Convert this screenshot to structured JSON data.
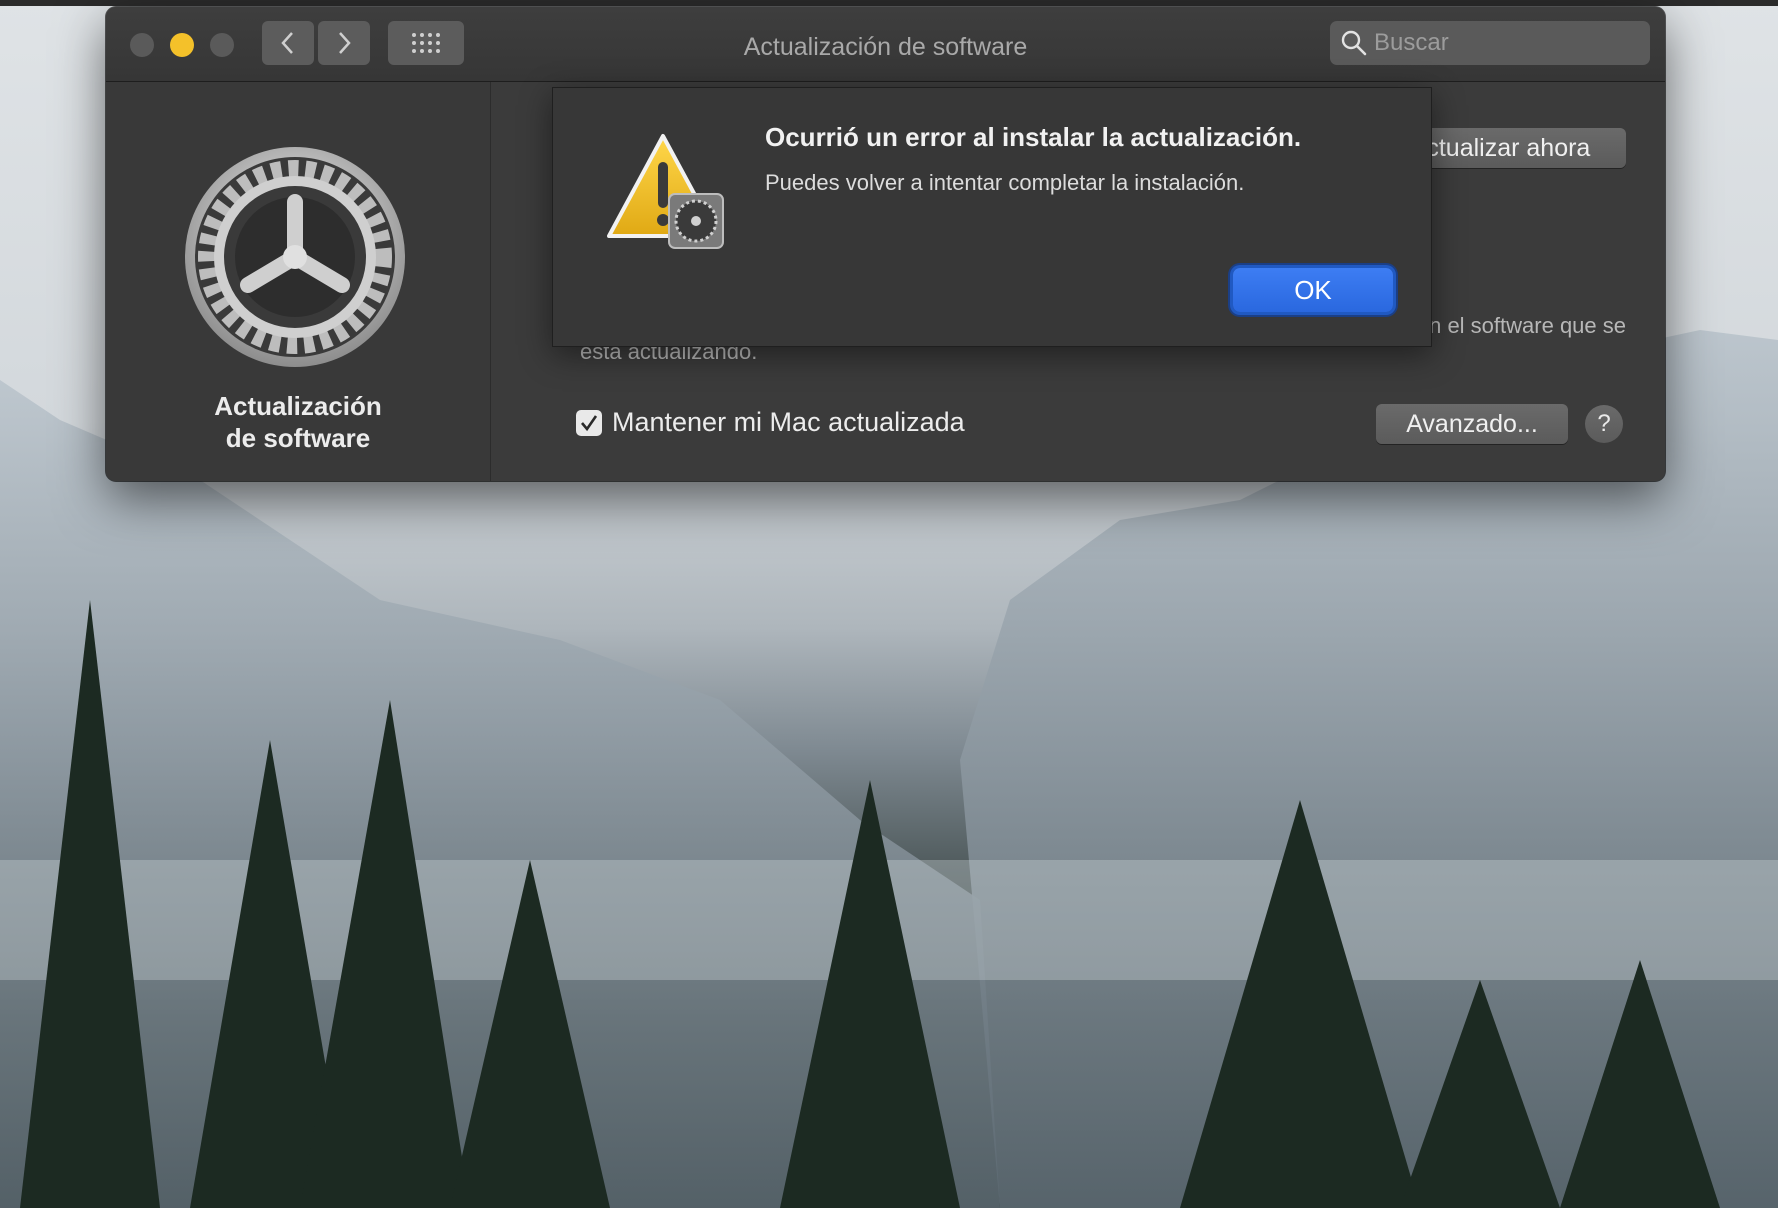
{
  "window": {
    "title": "Actualización de software",
    "search_placeholder": "Buscar",
    "traffic_lights": [
      "close",
      "minimize",
      "zoom"
    ]
  },
  "icons": {
    "nav_back": "chevron-left-icon",
    "nav_forward": "chevron-right-icon",
    "show_all": "grid-icon",
    "search": "search-icon",
    "preference_pane": "gear-icon",
    "alert": "warning-icon"
  },
  "sidebar": {
    "title": "Actualización de software"
  },
  "main": {
    "update_button": "Actualizar ahora",
    "description_line1_visible": "venía con el software que se",
    "description_line2": "está actualizando.",
    "keep_updated_label": "Mantener mi Mac actualizada",
    "keep_updated_checked": true,
    "advanced_button": "Avanzado...",
    "help_button": "?"
  },
  "alert": {
    "title": "Ocurrió un error al instalar la actualización.",
    "message": "Puedes volver a intentar completar la instalación.",
    "ok_button": "OK"
  },
  "colors": {
    "window_bg": "#3b3b3b",
    "accent_blue": "#2a68df",
    "minimize_yellow": "#f4c12a"
  }
}
